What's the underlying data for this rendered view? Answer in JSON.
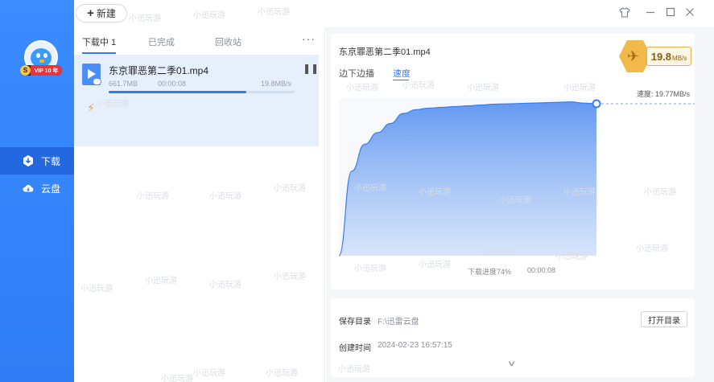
{
  "toolbar": {
    "new_label": "新建",
    "new_icon": "plus-icon"
  },
  "window_controls": [
    "shirt-skin-icon",
    "minimize-icon",
    "maximize-icon",
    "close-icon"
  ],
  "sidebar": {
    "badge": {
      "svip": "S",
      "vip": "VIP 10 年"
    },
    "items": [
      {
        "label": "下载",
        "icon": "download-icon",
        "active": true
      },
      {
        "label": "云盘",
        "icon": "cloud-icon",
        "active": false
      }
    ]
  },
  "list": {
    "tabs": [
      {
        "label": "下载中 1",
        "active": true
      },
      {
        "label": "已完成",
        "active": false
      },
      {
        "label": "回收站",
        "active": false
      }
    ],
    "more": "···",
    "items": [
      {
        "name": "东京罪恶第二季01.mp4",
        "size": "661.7MB",
        "time": "00:00:08",
        "speed": "19.8MB/s",
        "progress": 0.74,
        "pause_icon": "pause-icon",
        "accel_icon": "lightning-icon"
      }
    ]
  },
  "detail": {
    "title": "东京罪恶第二季01.mp4",
    "tabs": [
      {
        "label": "边下边播",
        "active": false
      },
      {
        "label": "速度",
        "active": true
      }
    ],
    "speed_badge": {
      "value": "19.8",
      "unit": "MB/s",
      "icon": "bird-icon"
    },
    "speed_label": "速度: 19.77MB/s",
    "progress_label": "下载进度74%",
    "elapsed": "00:00:08",
    "save_dir_label": "保存目录",
    "save_dir_value": "F:\\迅雷云盘",
    "open_dir_label": "打开目录",
    "created_label": "创建时间",
    "created_value": "2024-02-23 16:57:15",
    "expand_icon": "chevron-down-icon"
  },
  "chart_data": {
    "type": "area",
    "title": "",
    "xlabel": "",
    "ylabel": "",
    "ylim": [
      0,
      20.5
    ],
    "color": "#5b93f0",
    "x": [
      0,
      1,
      2,
      3,
      4,
      5,
      6,
      7,
      8,
      9,
      10,
      11,
      12,
      13,
      14,
      15,
      16,
      17,
      18,
      19,
      20
    ],
    "values": [
      0,
      11.0,
      14.5,
      16.0,
      17.2,
      18.5,
      19.0,
      19.2,
      19.3,
      19.4,
      19.5,
      19.6,
      19.7,
      19.75,
      19.8,
      19.85,
      19.9,
      19.95,
      20.0,
      19.85,
      19.77
    ],
    "current": 19.77
  },
  "watermark": "小迅玩游"
}
